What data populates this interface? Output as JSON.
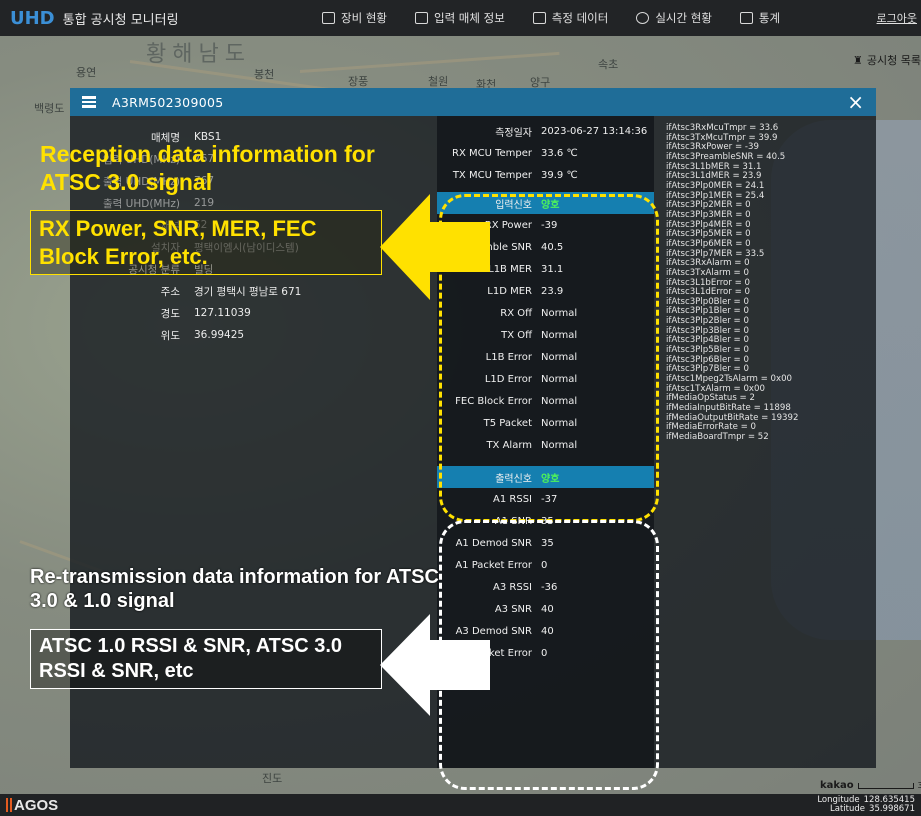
{
  "topbar": {
    "brand_abbr": "UHD",
    "brand_title": "통합 공시청 모니터링",
    "nav": [
      "장비 현황",
      "입력 매체 정보",
      "측정 데이터",
      "실시간 현황",
      "통계"
    ],
    "logout": "로그아웃"
  },
  "map": {
    "station_list": "공시청 목록",
    "labels": [
      "황해남도",
      "용연",
      "봉천",
      "장풍",
      "철원",
      "화천",
      "양구",
      "속초",
      "백령도",
      "진도"
    ],
    "kakao": "kakao",
    "scale": "32k"
  },
  "dialog": {
    "title": "A3RM502309005",
    "close": "×",
    "info": [
      {
        "k": "매체명",
        "v": "KBS1"
      },
      {
        "k": "입력 UHD(MHz)",
        "v": "767"
      },
      {
        "k": "출력 UHD(MHz)",
        "v": "767"
      },
      {
        "k": "출력 UHD(MHz)",
        "v": "219"
      },
      {
        "k": "채널",
        "v": "52"
      },
      {
        "k": "설치자",
        "v": "평택이엠시(남이디스템)"
      },
      {
        "k": "공시청 분류",
        "v": "빌딩"
      },
      {
        "k": "주소",
        "v": "경기 평택시 평남로 671"
      },
      {
        "k": "경도",
        "v": "127.11039"
      },
      {
        "k": "위도",
        "v": "36.99425"
      }
    ],
    "center_rows": [
      {
        "k": "측정일자",
        "v": "2023-06-27 13:14:36"
      },
      {
        "k": "RX MCU Temper",
        "v": "33.6 ℃"
      },
      {
        "k": "TX MCU Temper",
        "v": "39.9 ℃"
      },
      {
        "k": "입력신호",
        "v": "양호",
        "header": true
      },
      {
        "k": "RX Power",
        "v": "-39"
      },
      {
        "k": "Preamble SNR",
        "v": "40.5"
      },
      {
        "k": "L1B MER",
        "v": "31.1"
      },
      {
        "k": "L1D MER",
        "v": "23.9"
      },
      {
        "k": "RX Off",
        "v": "Normal"
      },
      {
        "k": "TX Off",
        "v": "Normal"
      },
      {
        "k": "L1B Error",
        "v": "Normal"
      },
      {
        "k": "L1D Error",
        "v": "Normal"
      },
      {
        "k": "FEC Block Error",
        "v": "Normal"
      },
      {
        "k": "T5 Packet",
        "v": "Normal"
      },
      {
        "k": "TX Alarm",
        "v": "Normal"
      },
      {
        "k": "출력신호",
        "v": "양호",
        "header": true
      },
      {
        "k": "A1 RSSI",
        "v": "-37"
      },
      {
        "k": "A1 SNR",
        "v": "35"
      },
      {
        "k": "A1 Demod SNR",
        "v": "35"
      },
      {
        "k": "A1 Packet Error",
        "v": "0"
      },
      {
        "k": "A3 RSSI",
        "v": "-36"
      },
      {
        "k": "A3 SNR",
        "v": "40"
      },
      {
        "k": "A3 Demod SNR",
        "v": "40"
      },
      {
        "k": "A3 Packet Error",
        "v": "0"
      }
    ],
    "raw": [
      "ifAtsc3RxMcuTmpr = 33.6",
      "ifAtsc3TxMcuTmpr = 39.9",
      "ifAtsc3RxPower = -39",
      "ifAtsc3PreambleSNR = 40.5",
      "ifAtsc3L1bMER = 31.1",
      "ifAtsc3L1dMER = 23.9",
      "ifAtsc3Plp0MER = 24.1",
      "ifAtsc3Plp1MER = 25.4",
      "ifAtsc3Plp2MER = 0",
      "ifAtsc3Plp3MER = 0",
      "ifAtsc3Plp4MER = 0",
      "ifAtsc3Plp5MER = 0",
      "ifAtsc3Plp6MER = 0",
      "ifAtsc3Plp7MER = 33.5",
      "ifAtsc3RxAlarm = 0",
      "ifAtsc3TxAlarm = 0",
      "ifAtsc3L1bError = 0",
      "ifAtsc3L1dError = 0",
      "ifAtsc3Plp0Bler = 0",
      "ifAtsc3Plp1Bler = 0",
      "ifAtsc3Plp2Bler = 0",
      "ifAtsc3Plp3Bler = 0",
      "ifAtsc3Plp4Bler = 0",
      "ifAtsc3Plp5Bler = 0",
      "ifAtsc3Plp6Bler = 0",
      "ifAtsc3Plp7Bler = 0",
      "ifAtsc1Mpeg2TsAlarm = 0x00",
      "ifAtsc1TxAlarm = 0x00",
      "ifMediaOpStatus = 2",
      "ifMediaInputBitRate = 11898",
      "ifMediaOutputBitRate = 19392",
      "ifMediaErrorRate = 0",
      "ifMediaBoardTmpr = 52"
    ]
  },
  "annotations": {
    "reception_title": "Reception data information for ATSC 3.0 signal",
    "reception_box": "RX Power, SNR, MER, FEC Block Error, etc.",
    "retrans_title": "Re-transmission data information for ATSC 3.0 & 1.0 signal",
    "retrans_box": "ATSC 1.0 RSSI & SNR, ATSC 3.0 RSSI & SNR, etc",
    "colors": {
      "yellow": "#ffe100",
      "white": "#ffffff",
      "accent": "#1f6d98",
      "ok_green": "#4ef25a"
    }
  },
  "bottombar": {
    "logo": "AGOS",
    "longitude_label": "Longitude",
    "longitude_value": "128.635415",
    "latitude_label": "Latitude",
    "latitude_value": "35.998671"
  }
}
